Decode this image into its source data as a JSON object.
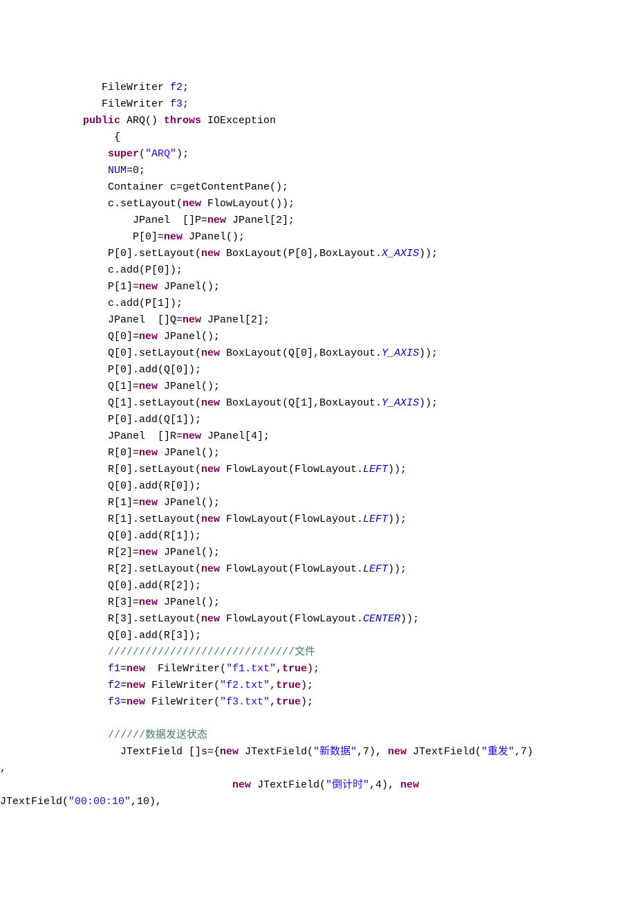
{
  "code": {
    "l1": "   FileWriter ",
    "l1b": ";",
    "f2": "f2",
    "l2": "   FileWriter ",
    "f3": "f3",
    "l2b": ";",
    "l3a": "public",
    "l3b": " ARQ() ",
    "l3c": "throws",
    "l3d": " IOException",
    "l4": "     {",
    "l5a": "    ",
    "l5b": "super",
    "l5c": "(",
    "l5d": "\"ARQ\"",
    "l5e": ");",
    "l6a": "    ",
    "l6b": "NUM",
    "l6c": "=0;",
    "l7": "    Container c=getContentPane();",
    "l8a": "    c.setLayout(",
    "l8b": "new",
    "l8c": " FlowLayout());",
    "l9a": "        JPanel  []P=",
    "l9b": "new",
    "l9c": " JPanel[2];",
    "l10a": "        P[0]=",
    "l10b": "new",
    "l10c": " JPanel();",
    "l11a": "    P[0].setLayout(",
    "l11b": "new",
    "l11c": " BoxLayout(P[0],BoxLayout.",
    "l11d": "X_AXIS",
    "l11e": "));",
    "l12": "    c.add(P[0]);",
    "l13a": "    P[1]=",
    "l13b": "new",
    "l13c": " JPanel();",
    "l14": "    c.add(P[1]);",
    "l15a": "    JPanel  []Q=",
    "l15b": "new",
    "l15c": " JPanel[2];",
    "l16a": "    Q[0]=",
    "l16b": "new",
    "l16c": " JPanel();",
    "l17a": "    Q[0].setLayout(",
    "l17b": "new",
    "l17c": " BoxLayout(Q[0],BoxLayout.",
    "l17d": "Y_AXIS",
    "l17e": "));",
    "l18": "    P[0].add(Q[0]);",
    "l19a": "    Q[1]=",
    "l19b": "new",
    "l19c": " JPanel();",
    "l20a": "    Q[1].setLayout(",
    "l20b": "new",
    "l20c": " BoxLayout(Q[1],BoxLayout.",
    "l20d": "Y_AXIS",
    "l20e": "));",
    "l21": "    P[0].add(Q[1]);",
    "l22a": "    JPanel  []R=",
    "l22b": "new",
    "l22c": " JPanel[4];",
    "l23a": "    R[0]=",
    "l23b": "new",
    "l23c": " JPanel();",
    "l24a": "    R[0].setLayout(",
    "l24b": "new",
    "l24c": " FlowLayout(FlowLayout.",
    "l24d": "LEFT",
    "l24e": "));",
    "l25": "    Q[0].add(R[0]);",
    "l26a": "    R[1]=",
    "l26b": "new",
    "l26c": " JPanel();",
    "l27a": "    R[1].setLayout(",
    "l27b": "new",
    "l27c": " FlowLayout(FlowLayout.",
    "l27d": "LEFT",
    "l27e": "));",
    "l28": "    Q[0].add(R[1]);",
    "l29a": "    R[2]=",
    "l29b": "new",
    "l29c": " JPanel();",
    "l30a": "    R[2].setLayout(",
    "l30b": "new",
    "l30c": " FlowLayout(FlowLayout.",
    "l30d": "LEFT",
    "l30e": "));",
    "l31": "    Q[0].add(R[2]);",
    "l32a": "    R[3]=",
    "l32b": "new",
    "l32c": " JPanel();",
    "l33a": "    R[3].setLayout(",
    "l33b": "new",
    "l33c": " FlowLayout(FlowLayout.",
    "l33d": "CENTER",
    "l33e": "));",
    "l34": "    Q[0].add(R[3]);",
    "l35a": "    ",
    "l35b": "//////////////////////////////文件",
    "l36a": "    ",
    "l36b": "f1",
    "l36c": "=",
    "l36d": "new",
    "l36e": "  FileWriter(",
    "l36f": "\"f1.txt\"",
    "l36g": ",",
    "l36h": "true",
    "l36i": ");",
    "l37a": "    ",
    "l37b": "f2",
    "l37c": "=",
    "l37d": "new",
    "l37e": " FileWriter(",
    "l37f": "\"f2.txt\"",
    "l37g": ",",
    "l37h": "true",
    "l37i": ");",
    "l38a": "    ",
    "l38b": "f3",
    "l38c": "=",
    "l38d": "new",
    "l38e": " FileWriter(",
    "l38f": "\"f3.txt\"",
    "l38g": ",",
    "l38h": "true",
    "l38i": ");",
    "l39": "",
    "l40a": "    ",
    "l40b": "//////数据发送状态",
    "l41a": "      JTextField []s={",
    "l41b": "new",
    "l41c": " JTextField(",
    "l41d": "\"新数据\"",
    "l41e": ",7), ",
    "l41f": "new",
    "l41g": " JTextField(",
    "l41h": "\"重发\"",
    "l41i": ",7)",
    "l42": ",",
    "l43a": "                        ",
    "l43b": "new",
    "l43c": " JTextField(",
    "l43d": "\"倒计时\"",
    "l43e": ",4), ",
    "l43f": "new",
    "l44a": "JTextField(",
    "l44b": "\"00:00:10\"",
    "l44c": ",10),"
  }
}
